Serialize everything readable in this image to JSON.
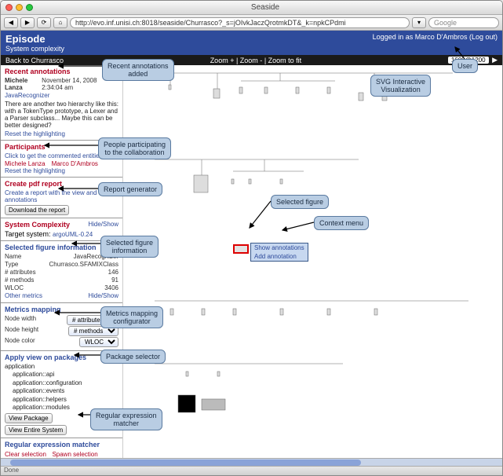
{
  "window": {
    "title": "Seaside"
  },
  "toolbar": {
    "url": "http://evo.inf.unisi.ch:8018/seaside/Churrasco?_s=jOIvkJaczQrotmkDT&_k=npkCPdmi",
    "search_placeholder": "Google"
  },
  "header": {
    "title": "Episode",
    "subtitle": "System complexity",
    "logged_in_prefix": "Logged in as ",
    "logged_in_user": "Marco D'Ambros",
    "logout": "(Log out)"
  },
  "blackbar": {
    "back_link": "Back to Churrasco",
    "zoom_in": "Zoom +",
    "zoom_out": "Zoom -",
    "zoom_fit": "Zoom to fit",
    "dimensions": "1600@1200"
  },
  "annotations_panel": {
    "title": "Recent annotations",
    "author": "Michele Lanza",
    "item": "JavaRecognizer",
    "date": "November 14, 2008  2:34:04 am",
    "text": "There are another two hierarchy like this: with a TokenType prototype, a Lexer and a Parser subclass... Maybe this can be better designed?",
    "reset": "Reset the highlighting"
  },
  "participants_panel": {
    "title": "Participants",
    "click_hint": "Click to get the commented entities",
    "p1": "Michele Lanza",
    "p2": "Marco D'Ambros",
    "reset": "Reset the highlighting"
  },
  "report_panel": {
    "title": "Create pdf report",
    "desc": "Create a report with the view and the annotations",
    "btn": "Download the report"
  },
  "syscomplex_panel": {
    "title": "System Complexity",
    "hideshow": "Hide/Show",
    "target_label": "Target system:",
    "target_value": "argoUML-0.24"
  },
  "figure_panel": {
    "title": "Selected figure information",
    "rows": {
      "Name": "JavaRecognizer",
      "Type": "Churrasco.SFAMIXClass",
      "# attributes": "146",
      "# methods": "91",
      "WLOC": "3406"
    },
    "other_metrics": "Other metrics",
    "hideshow": "Hide/Show"
  },
  "metrics_panel": {
    "title": "Metrics mapping",
    "rows": {
      "Node width": "# attributes",
      "Node height": "# methods",
      "Node color": "WLOC"
    }
  },
  "packages_panel": {
    "title": "Apply view on packages",
    "root": "application",
    "children": [
      "application::api",
      "application::configuration",
      "application::events",
      "application::helpers",
      "application::modules"
    ],
    "btn1": "View Package",
    "btn2": "View Entire System"
  },
  "regex_panel": {
    "title": "Regular expression matcher",
    "clear": "Clear selection",
    "spawn": "Spawn selection"
  },
  "context_menu": {
    "item1": "Show annotations",
    "item2": "Add annotation"
  },
  "callouts": {
    "recent": "Recent annotations\nadded",
    "user": "User",
    "svg": "SVG Interactive\nVisualization",
    "participants": "People participating\nto the collaboration",
    "report": "Report generator",
    "selfig": "Selected figure",
    "ctxmenu": "Context menu",
    "figinfo": "Selected figure\ninformation",
    "metrics": "Metrics mapping\nconfigurator",
    "packages": "Package selector",
    "regex": "Regular expression\nmatcher"
  },
  "status": "Done"
}
